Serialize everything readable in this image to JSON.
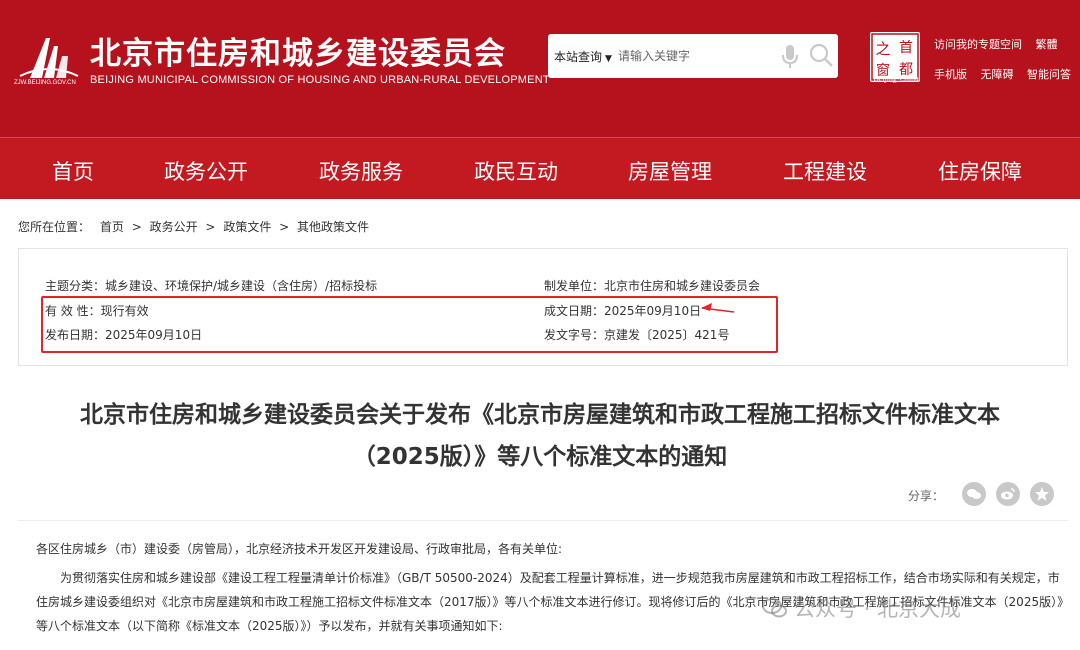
{
  "header": {
    "logo_caption": "ZJW.BEIJING.GOV.CN",
    "title": "北京市住房和城乡建设委员会",
    "subtitle": "BEIJING MUNICIPAL COMMISSION OF HOUSING AND URBAN-RURAL DEVELOPMENT",
    "search": {
      "scope": "本站查询",
      "placeholder": "请输入关键字"
    },
    "capital_badge": {
      "chars": [
        "之",
        "首",
        "窗",
        "都"
      ],
      "caption": "Beijing-China"
    },
    "links_row1": [
      "访问我的专题空间",
      "繁體"
    ],
    "links_row2": [
      "手机版",
      "无障碍",
      "智能问答"
    ]
  },
  "nav": {
    "items": [
      "首页",
      "政务公开",
      "政务服务",
      "政民互动",
      "房屋管理",
      "工程建设",
      "住房保障"
    ]
  },
  "breadcrumb": {
    "prefix": "您所在位置：",
    "items": [
      "首页",
      "政务公开",
      "政策文件",
      "其他政策文件"
    ],
    "separator": ">"
  },
  "meta": {
    "category": "主题分类：城乡建设、环境保护/城乡建设（含住房）/招标投标",
    "issuer": "制发单位：北京市住房和城乡建设委员会",
    "validity": "有 效 性：现行有效",
    "written_date": "成文日期：2025年09月10日",
    "publish_date": "发布日期：2025年09月10日",
    "doc_number": "发文字号：京建发〔2025〕421号"
  },
  "title_lines": [
    "北京市住房和城乡建设委员会关于发布《北京市房屋建筑和市政工程施工招标文件标准文本",
    "（2025版）》等八个标准文本的通知"
  ],
  "share": {
    "label": "分享：",
    "icons": [
      "wechat-icon",
      "weibo-icon",
      "favorite-icon"
    ]
  },
  "body": {
    "p1": "各区住房城乡（市）建设委（房管局），北京经济技术开发区开发建设局、行政审批局，各有关单位:",
    "p2": "为贯彻落实住房和城乡建设部《建设工程工程量清单计价标准》（GB/T 50500-2024）及配套工程量计算标准，进一步规范我市房屋建筑和市政工程招标工作，结合市场实际和有关规定，市住房城乡建设委组织对《北京市房屋建筑和市政工程施工招标文件标准文本（2017版）》等八个标准文本进行修订。现将修订后的《北京市房屋建筑和市政工程施工招标文件标准文本（2025版）》等八个标准文本（以下简称《标准文本（2025版）》）予以发布，并就有关事项通知如下:"
  },
  "watermark": "公众号 · 北京大成",
  "colors": {
    "header_bg": "#b6121d",
    "nav_bg": "#c31a22",
    "highlight": "#e3222b"
  }
}
